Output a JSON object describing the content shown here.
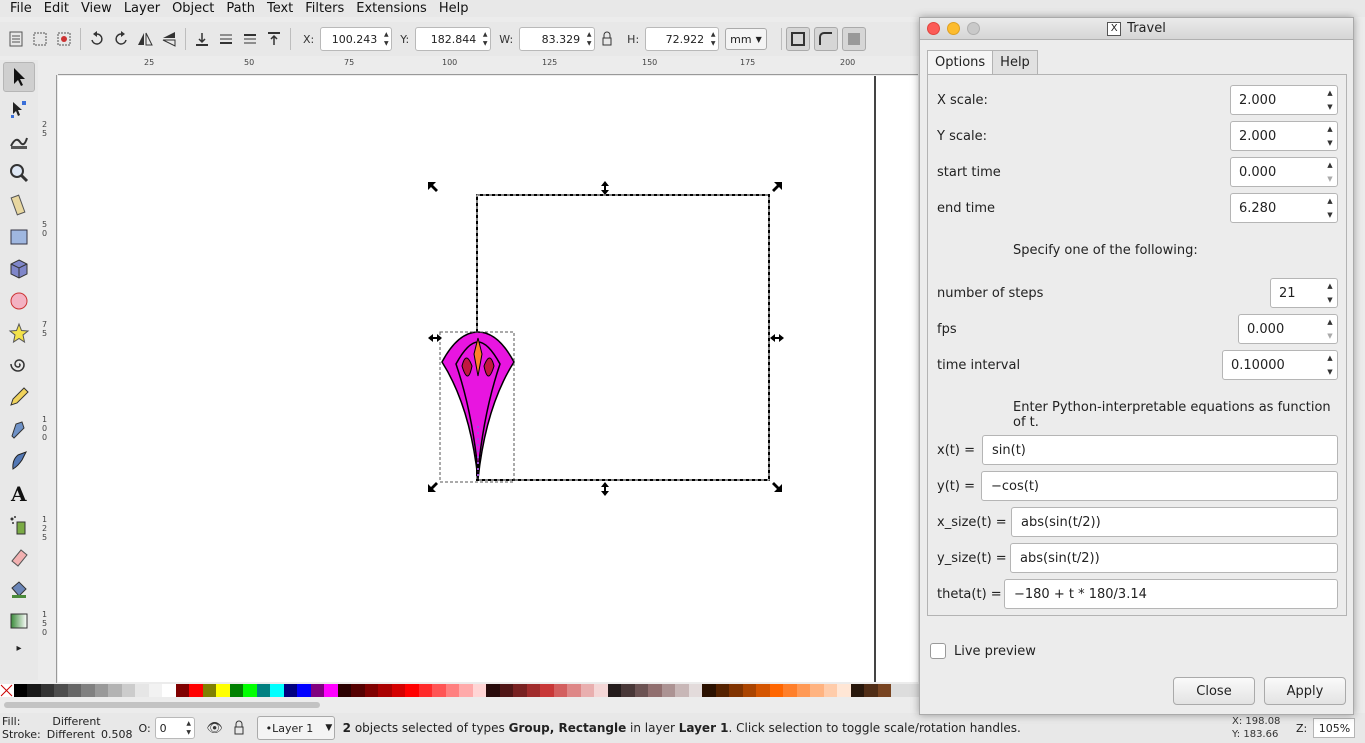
{
  "menubar": {
    "items": [
      "File",
      "Edit",
      "View",
      "Layer",
      "Object",
      "Path",
      "Text",
      "Filters",
      "Extensions",
      "Help"
    ]
  },
  "toolbar": {
    "x_label": "X:",
    "x_value": "100.243",
    "y_label": "Y:",
    "y_value": "182.844",
    "w_label": "W:",
    "w_value": "83.329",
    "h_label": "H:",
    "h_value": "72.922",
    "unit": "mm"
  },
  "ruler": {
    "h_ticks": [
      "25",
      "50",
      "75",
      "100",
      "125",
      "150",
      "175",
      "200"
    ],
    "v_ticks": [
      "25",
      "50",
      "75",
      "100",
      "125",
      "150"
    ]
  },
  "tools": [
    "selector-tool",
    "node-tool",
    "tweak-tool",
    "zoom-tool",
    "measure-tool",
    "rect-tool",
    "3dbox-tool",
    "ellipse-tool",
    "star-tool",
    "spiral-tool",
    "pencil-tool",
    "pen-tool",
    "calligraphy-tool",
    "text-tool",
    "spray-tool",
    "eraser-tool",
    "bucket-tool",
    "gradient-tool"
  ],
  "palette": {
    "colors": [
      "#000000",
      "#1a1a1a",
      "#333333",
      "#4d4d4d",
      "#666666",
      "#808080",
      "#999999",
      "#b3b3b3",
      "#cccccc",
      "#e6e6e6",
      "#f2f2f2",
      "#ffffff",
      "#800000",
      "#ff0000",
      "#808000",
      "#ffff00",
      "#008000",
      "#00ff00",
      "#008080",
      "#00ffff",
      "#000080",
      "#0000ff",
      "#800080",
      "#ff00ff",
      "#2b0000",
      "#550000",
      "#800000",
      "#aa0000",
      "#d40000",
      "#ff0000",
      "#ff2a2a",
      "#ff5555",
      "#ff8080",
      "#ffaaaa",
      "#ffd5d5",
      "#280b0b",
      "#501616",
      "#782121",
      "#a02c2c",
      "#c83737",
      "#d35f5f",
      "#de8787",
      "#e9afaf",
      "#f4d7d7",
      "#241c1c",
      "#483737",
      "#6c5353",
      "#916f6f",
      "#ac9393",
      "#c8b7b7",
      "#e3dbdb",
      "#2b1100",
      "#552200",
      "#803300",
      "#aa4400",
      "#d45500",
      "#ff6600",
      "#ff7f2a",
      "#ff9955",
      "#ffb380",
      "#ffccaa",
      "#ffe6d5",
      "#28170b",
      "#502d16",
      "#784421"
    ]
  },
  "status": {
    "fill_label": "Fill:",
    "fill_value": "Different",
    "stroke_label": "Stroke:",
    "stroke_value": "Different",
    "stroke_width": "0.508",
    "opacity_label": "O:",
    "opacity_value": "0",
    "layer": "•Layer 1",
    "message_count": "2",
    "message_mid": "objects selected of types",
    "message_types": "Group, Rectangle",
    "message_in": "in layer",
    "message_layer": "Layer 1",
    "message_end": ". Click selection to toggle scale/rotation handles.",
    "cursor_x_label": "X:",
    "cursor_x": "198.08",
    "cursor_y_label": "Y:",
    "cursor_y": "183.66",
    "zoom_label": "Z:",
    "zoom": "105%"
  },
  "dialog": {
    "title": "Travel",
    "x11_glyph": "X",
    "tabs": [
      "Options",
      "Help"
    ],
    "x_scale_label": "X scale:",
    "x_scale": "2.000",
    "y_scale_label": "Y scale:",
    "y_scale": "2.000",
    "start_time_label": "start time",
    "start_time": "0.000",
    "end_time_label": "end time",
    "end_time": "6.280",
    "specify_note": "Specify one of the following:",
    "steps_label": "number of steps",
    "steps": "21",
    "fps_label": "fps",
    "fps": "0.000",
    "interval_label": "time interval",
    "interval": "0.10000",
    "equations_note": "Enter Python-interpretable equations as function of t.",
    "xt_label": "x(t) =",
    "xt": "sin(t)",
    "yt_label": "y(t) =",
    "yt": "−cos(t)",
    "xsize_label": "x_size(t) =",
    "xsize": "abs(sin(t/2))",
    "ysize_label": "y_size(t) =",
    "ysize": "abs(sin(t/2))",
    "theta_label": "theta(t) =",
    "theta": "−180 + t * 180/3.14",
    "live_preview": "Live preview",
    "close_label": "Close",
    "apply_label": "Apply"
  }
}
